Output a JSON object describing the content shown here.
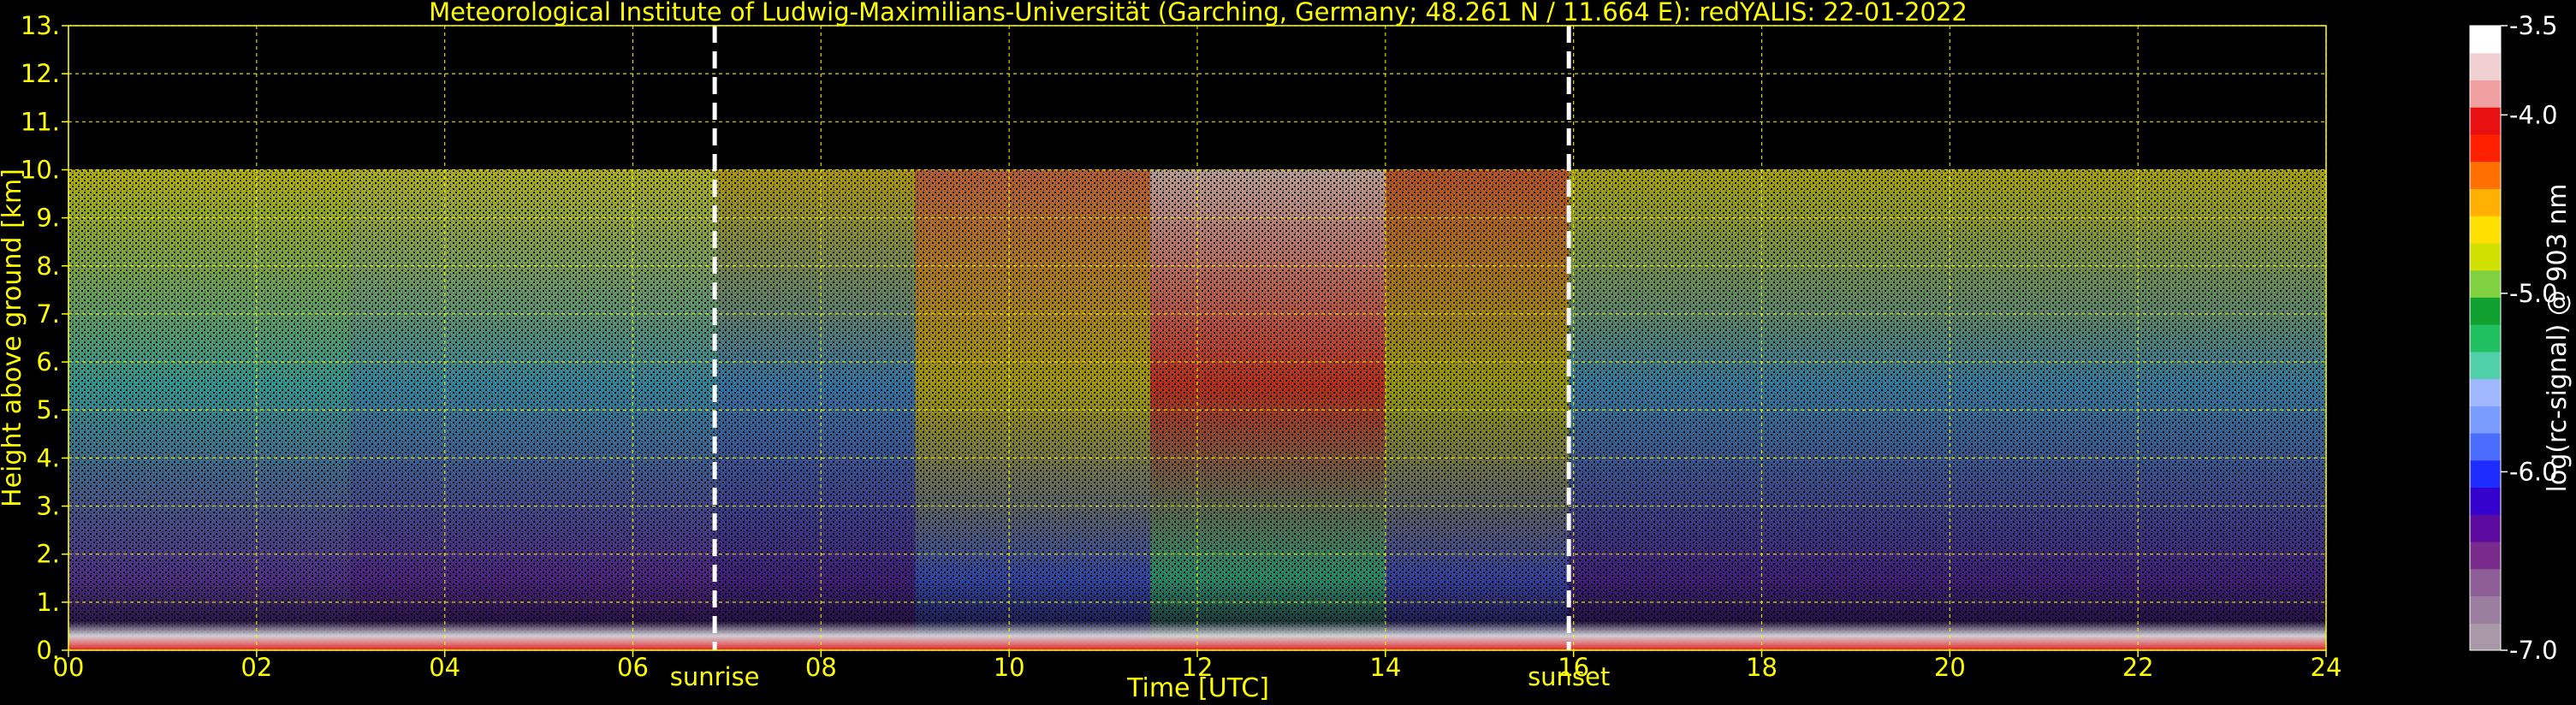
{
  "colors": {
    "background": "#000000",
    "axis_text": "#ffff00",
    "grid": "#ffff00",
    "colorbar_text": "#ffffff",
    "event_line": "#ffffff"
  },
  "chart_data": {
    "type": "heatmap",
    "title": "Meteorological Institute of Ludwig-Maximilians-Universität (Garching, Germany; 48.261 N / 11.664 E):    redYALIS: 22-01-2022",
    "xlabel": "Time [UTC]",
    "ylabel": "Height above ground [km]",
    "xlim": [
      0,
      24
    ],
    "ylim": [
      0,
      13
    ],
    "grid": true,
    "x_ticks": [
      0,
      2,
      4,
      6,
      8,
      10,
      12,
      14,
      16,
      18,
      20,
      22,
      24
    ],
    "x_tick_labels": [
      "00",
      "02",
      "04",
      "06",
      "08",
      "10",
      "12",
      "14",
      "16",
      "18",
      "20",
      "22",
      "24"
    ],
    "y_ticks": [
      0,
      1,
      2,
      3,
      4,
      5,
      6,
      7,
      8,
      9,
      10,
      11,
      12,
      13
    ],
    "y_tick_labels": [
      "0.",
      "1.",
      "2.",
      "3.",
      "4.",
      "5.",
      "6.",
      "7.",
      "8.",
      "9.",
      "10.",
      "11.",
      "12.",
      "13."
    ],
    "data_max_height_km": 10,
    "events": [
      {
        "label": "sunrise",
        "time": 6.87
      },
      {
        "label": "sunset",
        "time": 15.95
      }
    ],
    "colorbar": {
      "label": "log(rc-signal) @ 903 nm",
      "range": [
        -7.0,
        -3.5
      ],
      "ticks": [
        -3.5,
        -4.0,
        -5.0,
        -6.0,
        -7.0
      ],
      "tick_labels": [
        "-3.5",
        "-4.0",
        "-5.0",
        "-6.0",
        "-7.0"
      ],
      "colors_low_to_high": [
        "#a898a8",
        "#9b7f9e",
        "#8e5e96",
        "#7a2a8c",
        "#5d0aa0",
        "#3300cc",
        "#1f2cff",
        "#4a6cff",
        "#7a9cff",
        "#a0b8ff",
        "#4fd0a8",
        "#20c060",
        "#10a030",
        "#80d040",
        "#d0e000",
        "#ffe000",
        "#ffb000",
        "#ff7000",
        "#ff2000",
        "#e81010",
        "#f0a0a0",
        "#f0d0d0",
        "#ffffff"
      ]
    },
    "signal_profile": [
      {
        "time": 0,
        "upper_color": "#f5f000",
        "mid_color": "#3fd0c8",
        "low_color": "#6e3fb8"
      },
      {
        "time": 3,
        "upper_color": "#f0f020",
        "mid_color": "#3fb8d8",
        "low_color": "#6a30b0"
      },
      {
        "time": 6.9,
        "upper_color": "#f0d000",
        "mid_color": "#40a0e0",
        "low_color": "#5a2aa8"
      },
      {
        "time": 9,
        "upper_color": "#ff8040",
        "mid_color": "#e0d000",
        "low_color": "#4060e0"
      },
      {
        "time": 11.5,
        "upper_color": "#ffd8c8",
        "mid_color": "#ff4020",
        "low_color": "#30c090"
      },
      {
        "time": 14,
        "upper_color": "#ff7030",
        "mid_color": "#d0d000",
        "low_color": "#4858d8"
      },
      {
        "time": 15.95,
        "upper_color": "#e8e000",
        "mid_color": "#40a8d8",
        "low_color": "#5a2aa8"
      },
      {
        "time": 24,
        "upper_color": "#c8e030",
        "mid_color": "#3aa0d0",
        "low_color": "#6030a8"
      }
    ]
  }
}
